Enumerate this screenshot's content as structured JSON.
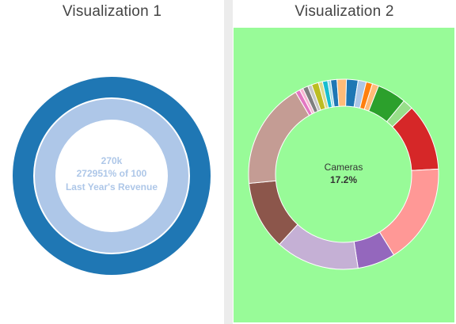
{
  "visualizations": [
    {
      "title": "Visualization 1"
    },
    {
      "title": "Visualization 2"
    }
  ],
  "colors": {
    "panel2_background": "#98fb98",
    "gauge_outer": "#1f77b4",
    "gauge_inner": "#aec7e8",
    "gauge_text": "#aec7e8",
    "center_text": "#333333"
  },
  "chart_data": [
    {
      "type": "gauge-donut",
      "value": 270000,
      "target": 100,
      "labels": {
        "value": "270k",
        "percent": "272951% of 100",
        "caption": "Last Year's Revenue"
      }
    },
    {
      "type": "donut",
      "center_label": {
        "name": "Cameras",
        "value": "17.2%"
      },
      "slices": [
        {
          "value": 2.0,
          "color": "#1f77b4"
        },
        {
          "value": 1.4,
          "color": "#aec7e8"
        },
        {
          "value": 1.1,
          "color": "#ff7f0e"
        },
        {
          "value": 1.1,
          "color": "#ffbb78"
        },
        {
          "value": 5.0,
          "color": "#2ca02c"
        },
        {
          "value": 1.8,
          "color": "#98df8a"
        },
        {
          "value": 11.5,
          "color": "#d62728"
        },
        {
          "value": 17.2,
          "color": "#ff9896"
        },
        {
          "value": 6.5,
          "color": "#9467bd"
        },
        {
          "value": 14.4,
          "color": "#c5b0d5"
        },
        {
          "value": 11.8,
          "color": "#8c564b"
        },
        {
          "value": 18.3,
          "color": "#c49c94"
        },
        {
          "value": 0.8,
          "color": "#e377c2"
        },
        {
          "value": 0.6,
          "color": "#f7b6d2"
        },
        {
          "value": 0.9,
          "color": "#7f7f7f"
        },
        {
          "value": 0.7,
          "color": "#c7c7c7"
        },
        {
          "value": 1.2,
          "color": "#bcbd22"
        },
        {
          "value": 0.7,
          "color": "#dbdb8d"
        },
        {
          "value": 0.9,
          "color": "#17becf"
        },
        {
          "value": 0.5,
          "color": "#9edae5"
        },
        {
          "value": 1.1,
          "color": "#1f77b4"
        },
        {
          "value": 1.6,
          "color": "#ffbb78"
        }
      ]
    }
  ]
}
